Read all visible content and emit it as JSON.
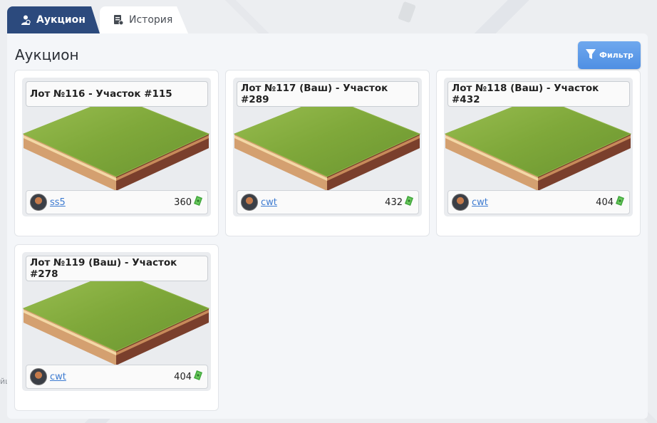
{
  "tabs": [
    {
      "label": "Аукцион",
      "icon": "bidder-icon",
      "active": true
    },
    {
      "label": "История",
      "icon": "document-list-icon",
      "active": false
    }
  ],
  "page": {
    "title": "Аукцион",
    "filter_label": "Фильтр",
    "background_edge_text": "йш"
  },
  "colors": {
    "active_tab": "#2c4a7d",
    "filter_button": "#5a98e8",
    "link": "#3d7bd1",
    "grass": "#7fa83a",
    "soil": "#c9855a",
    "currency": "#3fa63a"
  },
  "currency_icon": "cash-icon",
  "lots": [
    {
      "title": "Лот №116 - Участок #115",
      "owner": "ss5",
      "price": "360"
    },
    {
      "title": "Лот №117 (Ваш) - Участок #289",
      "owner": "cwt",
      "price": "432"
    },
    {
      "title": "Лот №118 (Ваш) - Участок #432",
      "owner": "cwt",
      "price": "404"
    },
    {
      "title": "Лот №119 (Ваш) - Участок #278",
      "owner": "cwt",
      "price": "404"
    }
  ]
}
